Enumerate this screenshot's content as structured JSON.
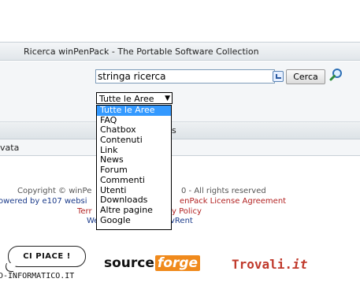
{
  "header": {
    "title": "Ricerca winPenPack - The Portable Software Collection"
  },
  "search": {
    "query": "stringa ricerca",
    "button_label": "Cerca",
    "selected_area": "Tutte le Aree"
  },
  "area_dropdown": {
    "options": [
      "Tutte le Aree",
      "FAQ",
      "Chatbox",
      "Contenuti",
      "Link",
      "News",
      "Forum",
      "Commenti",
      "Utenti",
      "Downloads",
      "Altre pagine",
      "Google"
    ]
  },
  "table": {
    "header_tail": "s",
    "row_text": "vata"
  },
  "footer": {
    "copyright_left": "Copyright © winPe",
    "copyright_right": "0 - All rights reserved",
    "powered_left": "owered by e107 websi",
    "powered_right": "enPack License Agreement",
    "terms_left": "Terr",
    "terms_right": "y Policy",
    "web_left": "We",
    "web_right": "vRent"
  },
  "badges": {
    "speech_label": "CI PIACE !",
    "informatico_text": "D-INFORMATICO.IT",
    "sourceforge_a": "source",
    "sourceforge_b": "forge",
    "trovali_a": "Trovali.",
    "trovali_b": "it"
  },
  "colors": {
    "accent_selected": "#3399ff",
    "link_red": "#b22222",
    "link_blue": "#1a3a8a",
    "sourceforge_orange": "#f08a1c"
  },
  "icons": [
    "keyboard-icon",
    "magnifier-icon",
    "dropdown-arrow-icon"
  ]
}
